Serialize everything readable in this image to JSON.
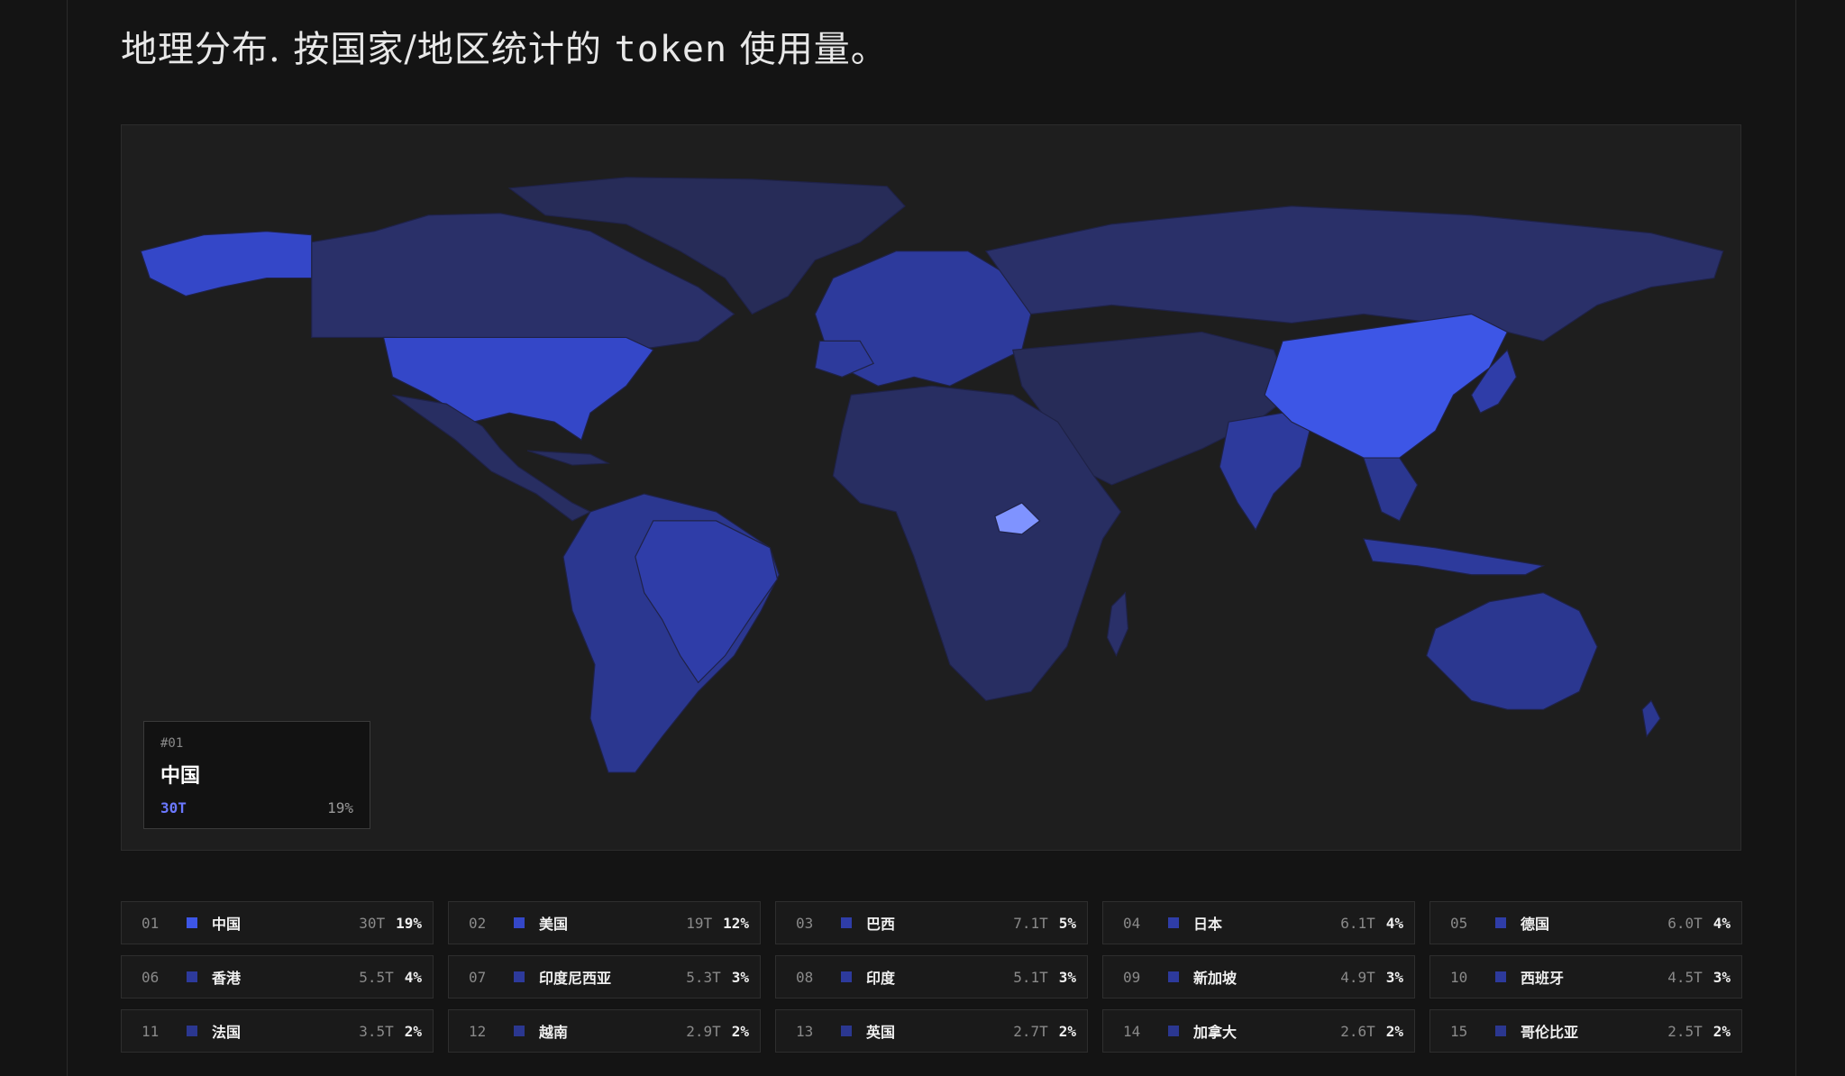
{
  "page": {
    "title_prefix": "地理分布. 按国家/地区统计的",
    "title_token": "token",
    "title_suffix": "使用量。"
  },
  "colors": {
    "background": "#141414",
    "panel": "#1e1e1e",
    "accent": "#6b78ff",
    "country_base": "#2a3066"
  },
  "tooltip": {
    "rank": "#01",
    "name": "中国",
    "value": "30T",
    "percent": "19%"
  },
  "ranking": [
    {
      "rank": "01",
      "name": "中国",
      "value": "30T",
      "percent": "19%",
      "color": "#3d56e6"
    },
    {
      "rank": "02",
      "name": "美国",
      "value": "19T",
      "percent": "12%",
      "color": "#3447c8"
    },
    {
      "rank": "03",
      "name": "巴西",
      "value": "7.1T",
      "percent": "5%",
      "color": "#2f3da8"
    },
    {
      "rank": "04",
      "name": "日本",
      "value": "6.1T",
      "percent": "4%",
      "color": "#2f3da8"
    },
    {
      "rank": "05",
      "name": "德国",
      "value": "6.0T",
      "percent": "4%",
      "color": "#2f3da8"
    },
    {
      "rank": "06",
      "name": "香港",
      "value": "5.5T",
      "percent": "4%",
      "color": "#2d3a9c"
    },
    {
      "rank": "07",
      "name": "印度尼西亚",
      "value": "5.3T",
      "percent": "3%",
      "color": "#2d3a9c"
    },
    {
      "rank": "08",
      "name": "印度",
      "value": "5.1T",
      "percent": "3%",
      "color": "#2d3a9c"
    },
    {
      "rank": "09",
      "name": "新加坡",
      "value": "4.9T",
      "percent": "3%",
      "color": "#2d3a9c"
    },
    {
      "rank": "10",
      "name": "西班牙",
      "value": "4.5T",
      "percent": "3%",
      "color": "#2d3a9c"
    },
    {
      "rank": "11",
      "name": "法国",
      "value": "3.5T",
      "percent": "2%",
      "color": "#2b3790"
    },
    {
      "rank": "12",
      "name": "越南",
      "value": "2.9T",
      "percent": "2%",
      "color": "#2b3790"
    },
    {
      "rank": "13",
      "name": "英国",
      "value": "2.7T",
      "percent": "2%",
      "color": "#2b3790"
    },
    {
      "rank": "14",
      "name": "加拿大",
      "value": "2.6T",
      "percent": "2%",
      "color": "#2b3790"
    },
    {
      "rank": "15",
      "name": "哥伦比亚",
      "value": "2.5T",
      "percent": "2%",
      "color": "#2b3790"
    }
  ]
}
